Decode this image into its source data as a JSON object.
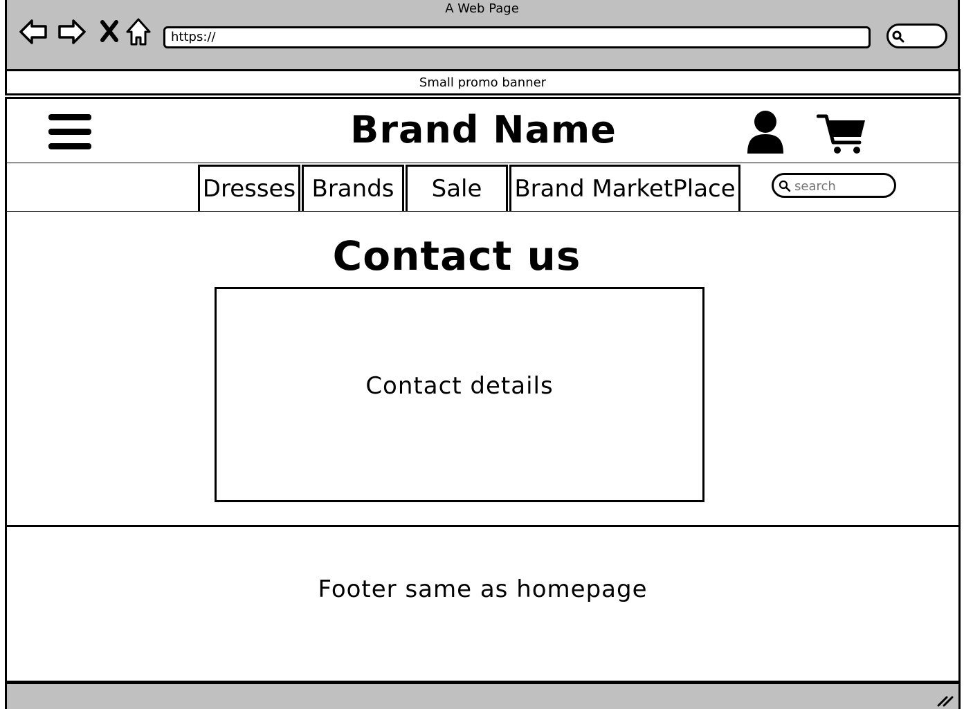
{
  "browser": {
    "window_title": "A Web Page",
    "url": "https://",
    "nav_icons": [
      "back-arrow-icon",
      "forward-arrow-icon",
      "close-icon",
      "home-icon"
    ],
    "search_icon": "search-icon"
  },
  "promo": {
    "text": "Small promo banner"
  },
  "header": {
    "menu_icon": "hamburger-menu-icon",
    "brand_name": "Brand Name",
    "account_icon": "user-icon",
    "cart_icon": "shopping-cart-icon"
  },
  "nav": {
    "tabs": [
      {
        "label": "Dresses"
      },
      {
        "label": "Brands"
      },
      {
        "label": "Sale"
      },
      {
        "label": "Brand MarketPlace"
      }
    ],
    "search_placeholder": "search"
  },
  "main": {
    "title": "Contact us",
    "contact_box_text": "Contact details"
  },
  "footer": {
    "text": "Footer same as homepage"
  },
  "colors": {
    "chrome": "#c0c0c0",
    "ink": "#000000",
    "page": "#ffffff",
    "placeholder": "#888888"
  }
}
